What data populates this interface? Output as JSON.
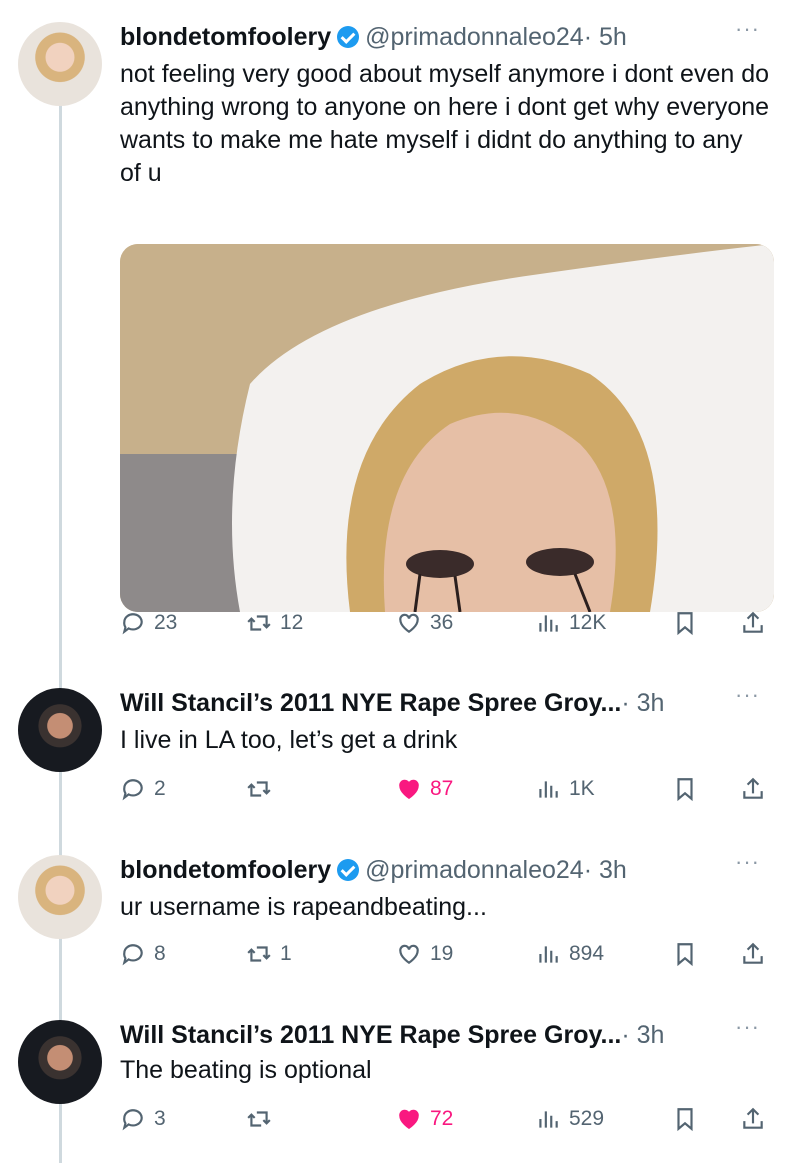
{
  "tweets": [
    {
      "name": "blondetomfoolery",
      "verified": true,
      "handle": "@primadonnaleo24",
      "time": "· 5h",
      "text": "not feeling very good about myself anymore i dont even do anything wrong to anyone on here i dont get why everyone wants to make me hate myself i didnt do anything to any of u",
      "replies": "23",
      "retweets": "12",
      "likes": "36",
      "views": "12K",
      "liked": false
    },
    {
      "name": "Will Stancil’s 2011 NYE Rape Spree Groy...",
      "verified": false,
      "handle": "",
      "time": "· 3h",
      "text": "I live in LA too, let’s get a drink",
      "replies": "2",
      "retweets": "",
      "likes": "87",
      "views": "1K",
      "liked": true
    },
    {
      "name": "blondetomfoolery",
      "verified": true,
      "handle": "@primadonnaleo24",
      "time": "· 3h",
      "text": "ur username is rapeandbeating...",
      "replies": "8",
      "retweets": "1",
      "likes": "19",
      "views": "894",
      "liked": false
    },
    {
      "name": "Will Stancil’s 2011 NYE Rape Spree Groy...",
      "verified": false,
      "handle": "",
      "time": "· 3h",
      "text": "The beating is optional",
      "replies": "3",
      "retweets": "",
      "likes": "72",
      "views": "529",
      "liked": true
    }
  ],
  "more_label": "···",
  "colors": {
    "like_active": "#f91880",
    "verified": "#1d9bf0",
    "muted": "#536471"
  },
  "icons": [
    "reply-icon",
    "retweet-icon",
    "heart-icon",
    "views-icon",
    "bookmark-icon",
    "share-icon"
  ]
}
